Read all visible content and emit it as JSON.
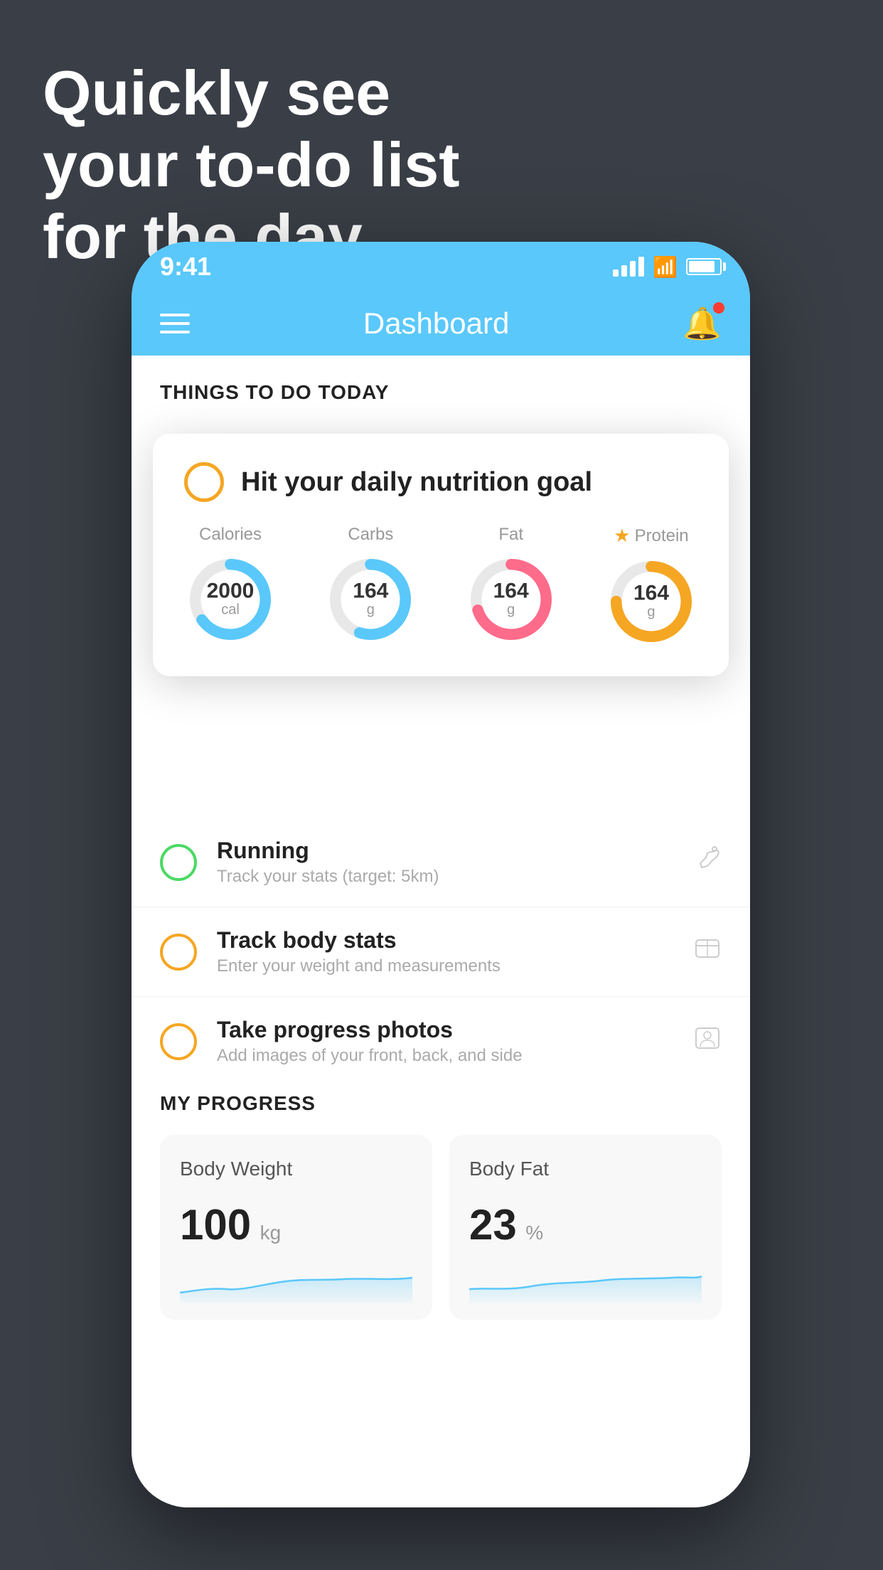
{
  "headline": {
    "line1": "Quickly see",
    "line2": "your to-do list",
    "line3": "for the day."
  },
  "status_bar": {
    "time": "9:41"
  },
  "nav": {
    "title": "Dashboard"
  },
  "things_section": {
    "heading": "THINGS TO DO TODAY"
  },
  "nutrition_card": {
    "title": "Hit your daily nutrition goal",
    "stats": [
      {
        "label": "Calories",
        "value": "2000",
        "unit": "cal",
        "color": "#5ac8fa",
        "percent": 65
      },
      {
        "label": "Carbs",
        "value": "164",
        "unit": "g",
        "color": "#5ac8fa",
        "percent": 55
      },
      {
        "label": "Fat",
        "value": "164",
        "unit": "g",
        "color": "#ff6b8a",
        "percent": 70
      },
      {
        "label": "Protein",
        "value": "164",
        "unit": "g",
        "color": "#f5a623",
        "percent": 75,
        "starred": true
      }
    ]
  },
  "todo_items": [
    {
      "id": "running",
      "title": "Running",
      "subtitle": "Track your stats (target: 5km)",
      "circle_color": "green",
      "icon": "👟"
    },
    {
      "id": "body-stats",
      "title": "Track body stats",
      "subtitle": "Enter your weight and measurements",
      "circle_color": "yellow",
      "icon": "⊡"
    },
    {
      "id": "photos",
      "title": "Take progress photos",
      "subtitle": "Add images of your front, back, and side",
      "circle_color": "yellow",
      "icon": "👤"
    }
  ],
  "progress": {
    "heading": "MY PROGRESS",
    "cards": [
      {
        "title": "Body Weight",
        "value": "100",
        "unit": "kg"
      },
      {
        "title": "Body Fat",
        "value": "23",
        "unit": "%"
      }
    ]
  }
}
